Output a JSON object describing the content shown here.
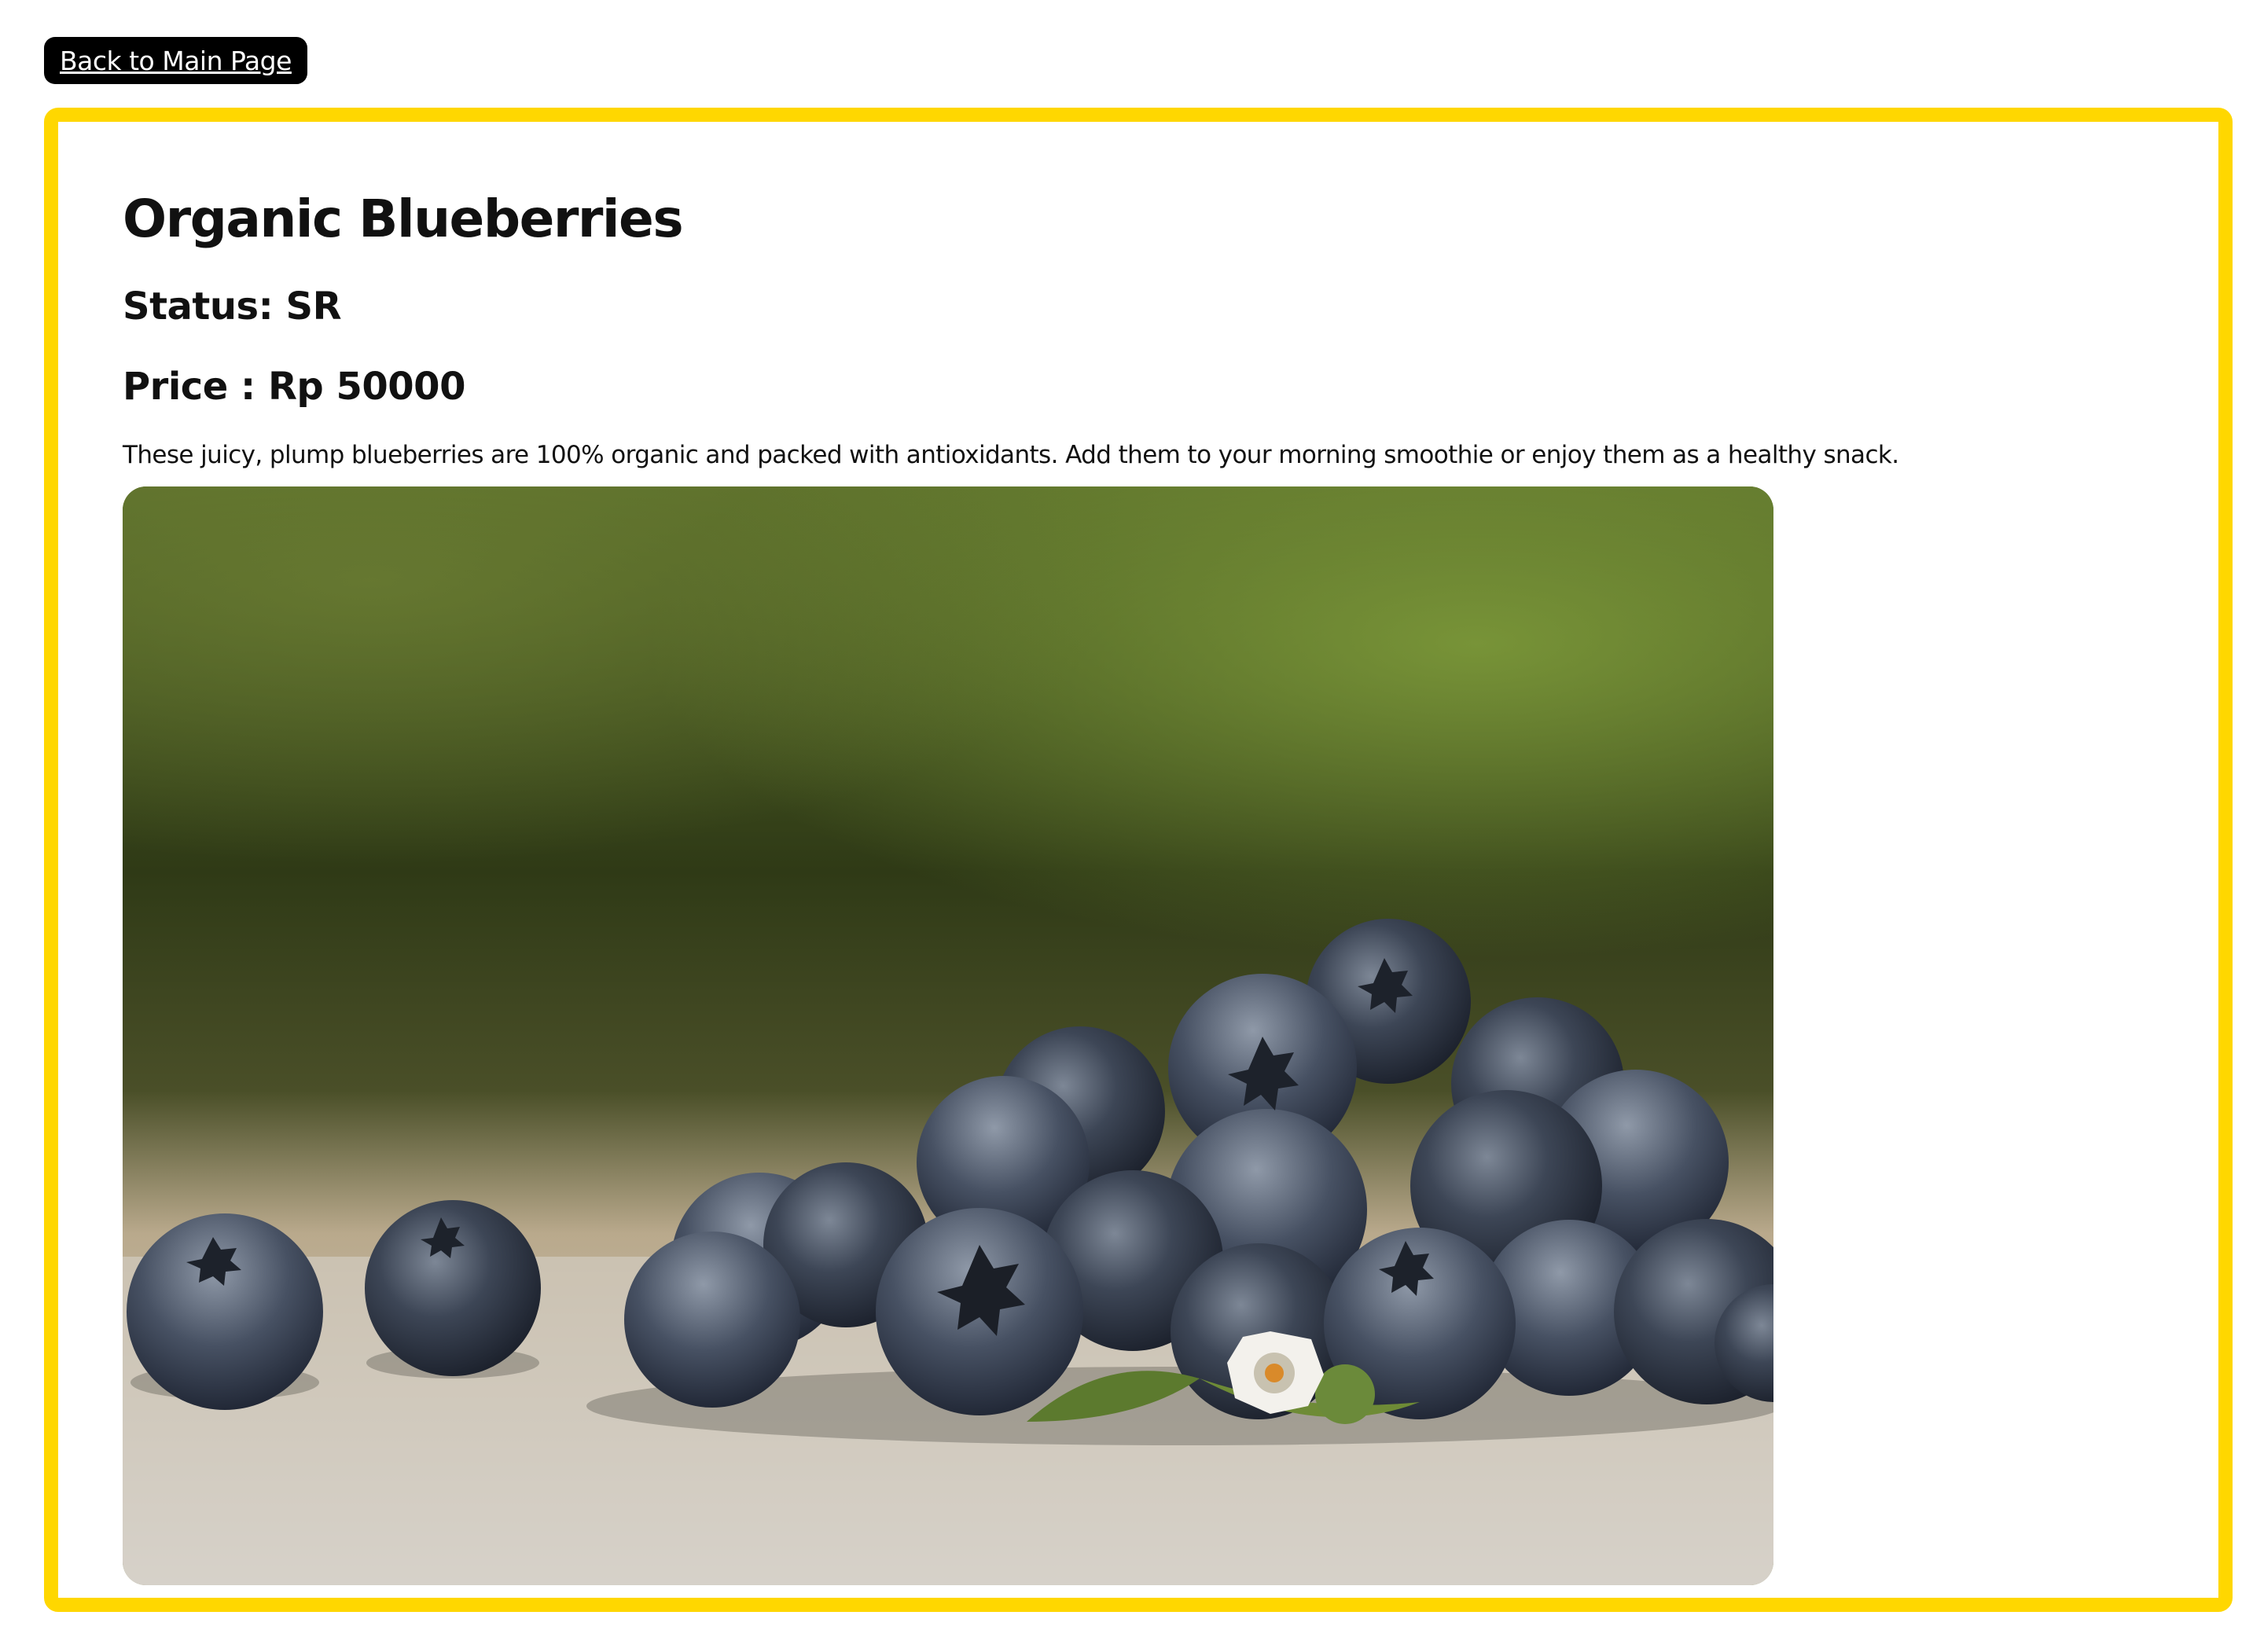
{
  "nav": {
    "back_label": "Back to Main Page"
  },
  "product": {
    "title": "Organic Blueberries",
    "status_label": "Status:",
    "status_value": "SR",
    "price_label": "Price :",
    "price_value": "Rp 50000",
    "description": "These juicy, plump blueberries are 100% organic and packed with antioxidants. Add them to your morning smoothie or enjoy them as a healthy snack.",
    "image_subject": "blueberries-photo"
  },
  "colors": {
    "accent_border": "#ffd700",
    "button_bg": "#000000",
    "button_text": "#ffffff"
  }
}
